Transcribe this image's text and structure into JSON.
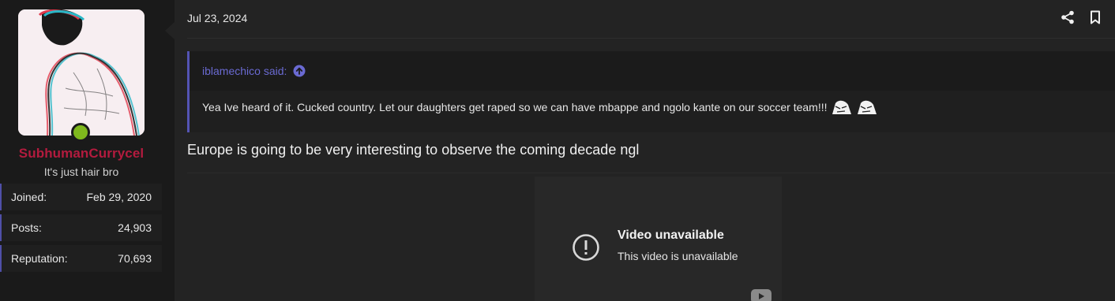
{
  "user": {
    "username": "SubhumanCurrycel",
    "title": "It's just hair bro",
    "online": true,
    "username_color": "#b31b3e",
    "stats": [
      {
        "label": "Joined:",
        "value": "Feb 29, 2020"
      },
      {
        "label": "Posts:",
        "value": "24,903"
      },
      {
        "label": "Reputation:",
        "value": "70,693"
      }
    ]
  },
  "message": {
    "date": "Jul 23, 2024",
    "actions": [
      "share-icon",
      "bookmark-icon"
    ],
    "quote": {
      "author_line": "iblamechico said:",
      "text": "Yea Ive heard of it. Cucked country. Let our daughters get raped so we can have mbappe and ngolo kante on our soccer team!!!",
      "emojis": [
        "wojak-icon",
        "wojak-icon"
      ]
    },
    "text": "Europe is going to be very interesting to observe the coming decade ngl",
    "embed": {
      "title": "Video unavailable",
      "subtitle": "This video is unavailable"
    }
  },
  "colors": {
    "accent": "#5454b4",
    "online": "#7fb81d",
    "background": "#1e1e1e"
  }
}
